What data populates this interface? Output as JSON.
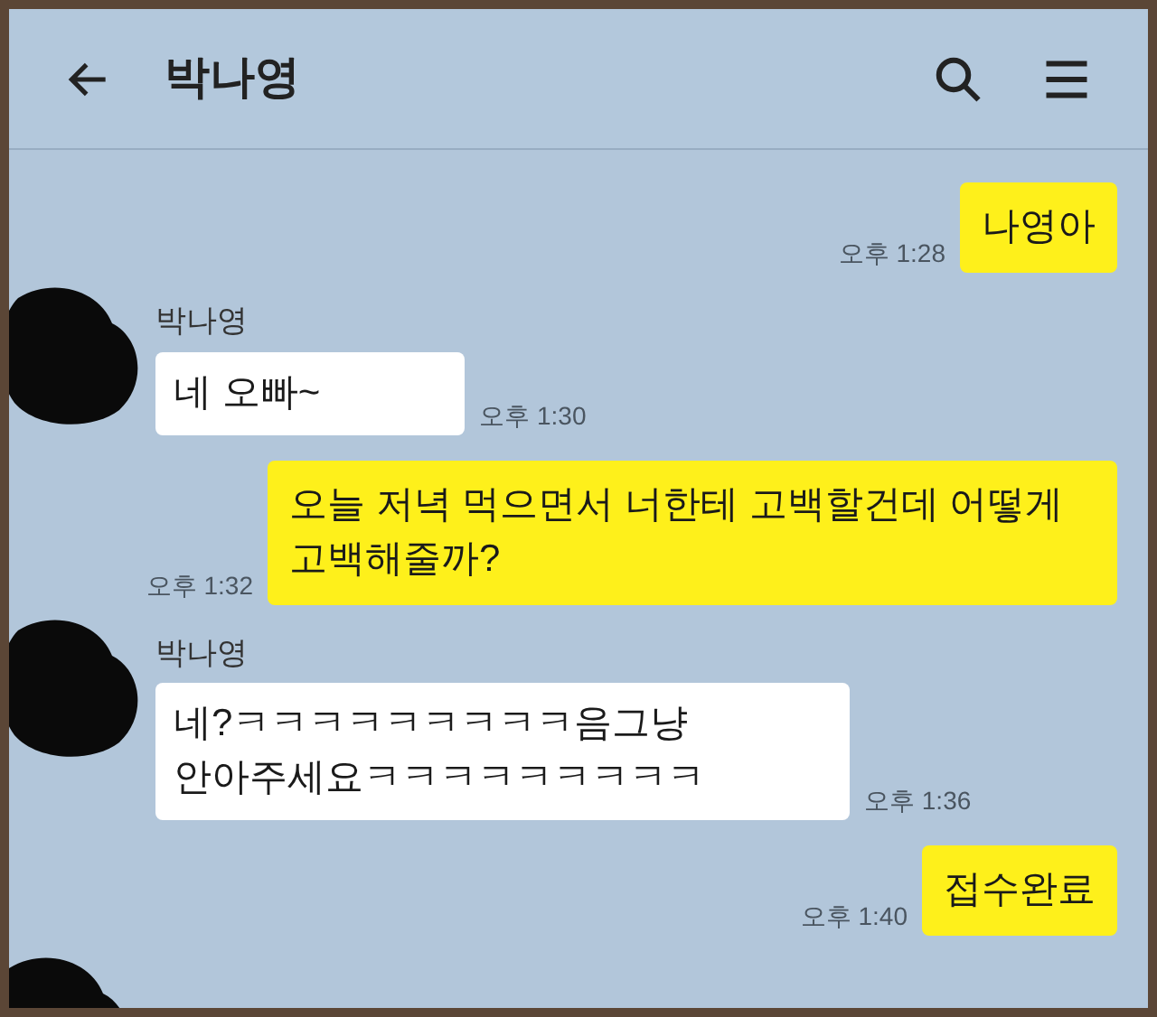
{
  "header": {
    "title": "박나영"
  },
  "messages": [
    {
      "kind": "sent",
      "text": "나영아",
      "time": "오후 1:28"
    },
    {
      "kind": "received",
      "sender": "박나영",
      "lines": [
        "네 오빠~"
      ],
      "time": "오후 1:30"
    },
    {
      "kind": "sent",
      "text": "오늘 저녁 먹으면서 너한테 고백할건데 어떻게 고백해줄까?",
      "time": "오후 1:32"
    },
    {
      "kind": "received",
      "sender": "박나영",
      "lines": [
        "네?ㅋㅋㅋㅋㅋㅋㅋㅋㅋ음그냥",
        "안아주세요ㅋㅋㅋㅋㅋㅋㅋㅋㅋ"
      ],
      "time": "오후 1:36"
    },
    {
      "kind": "sent",
      "text": "접수완료",
      "time": "오후 1:40"
    }
  ]
}
